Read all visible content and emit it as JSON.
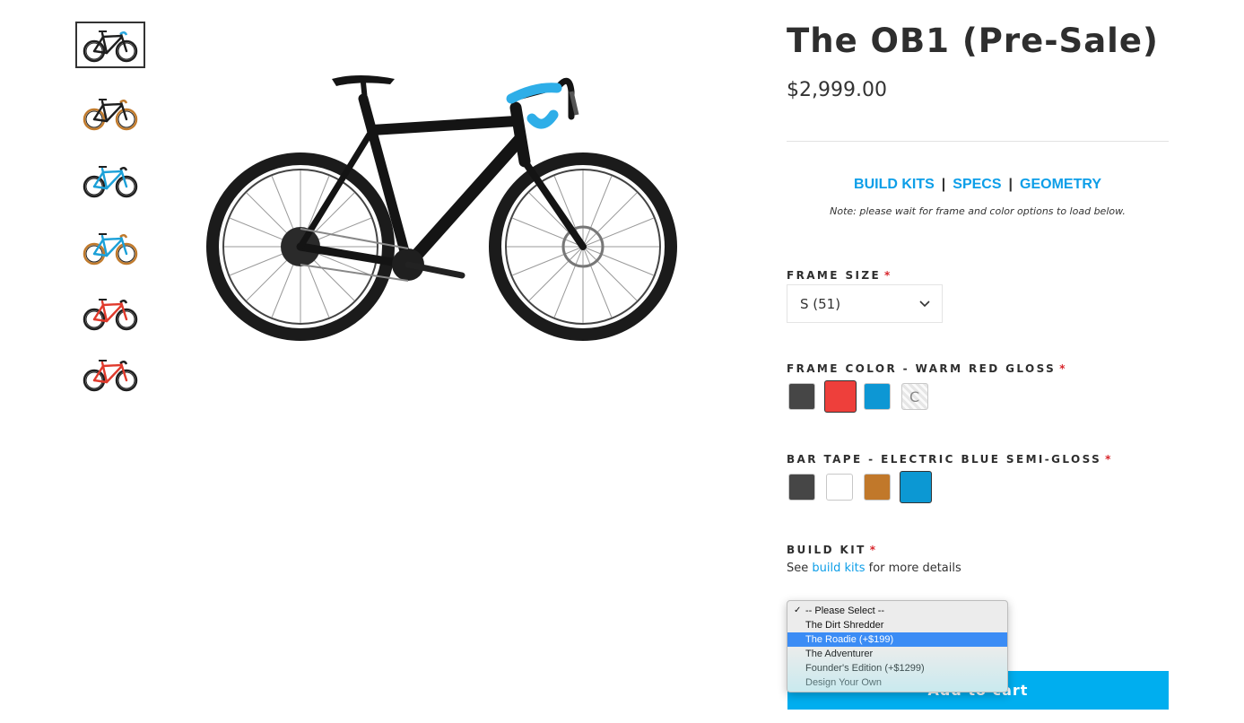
{
  "product": {
    "title": "The OB1 (Pre-Sale)",
    "price": "$2,999.00"
  },
  "links": {
    "build_kits": "BUILD KITS",
    "specs": "SPECS",
    "geometry": "GEOMETRY",
    "separator": "|",
    "note": "Note: please wait for frame and color options to load below."
  },
  "thumbnails": [
    {
      "frame_color": "#1e1e1e",
      "tape_color": "#2aa8e0",
      "selected": true
    },
    {
      "frame_color": "#1e1e1e",
      "tape_color": "#c07a2c",
      "selected": false
    },
    {
      "frame_color": "#1ba0d8",
      "tape_color": "#1e1e1e",
      "selected": false
    },
    {
      "frame_color": "#1ba0d8",
      "tape_color": "#c07a2c",
      "selected": false
    },
    {
      "frame_color": "#e03a2c",
      "tape_color": "#1e1e1e",
      "selected": false
    },
    {
      "frame_color": "#e03a2c",
      "tape_color": "#1e1e1e",
      "selected": false
    }
  ],
  "frame_size": {
    "label": "FRAME SIZE",
    "required": "*",
    "value": "S (51)"
  },
  "frame_color": {
    "label": "FRAME COLOR - WARM RED GLOSS",
    "required": "*",
    "swatches": [
      "#464646",
      "#ee3f3b",
      "#0d97d4",
      "#f2f2f2"
    ],
    "selected_index": 1
  },
  "bar_tape": {
    "label": "BAR TAPE - ELECTRIC BLUE SEMI-GLOSS",
    "required": "*",
    "swatches": [
      "#464646",
      "#ffffff",
      "#c1782a",
      "#0c98d3"
    ],
    "selected_index": 3
  },
  "build_kit": {
    "label": "BUILD KIT",
    "required": "*",
    "note_prefix": "See",
    "note_link": "build kits",
    "note_suffix": "for more details",
    "options": [
      "-- Please Select --",
      "The Dirt Shredder",
      "The Roadie (+$199)",
      "The Adventurer",
      "Founder's Edition (+$1299)",
      "Design Your Own"
    ],
    "checked_index": 0,
    "highlighted_index": 2
  },
  "cart": {
    "label": "Add to cart"
  },
  "colors": {
    "accent": "#00aeef",
    "link": "#0d9ee8",
    "required": "#d8262c"
  }
}
